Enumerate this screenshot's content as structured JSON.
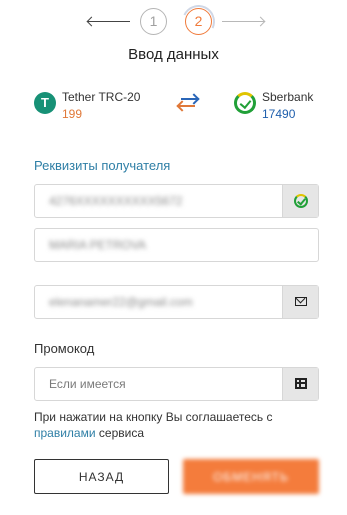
{
  "stepper": {
    "step1": "1",
    "step2": "2"
  },
  "title": "Ввод данных",
  "exchange": {
    "from": {
      "name": "Tether TRC-20",
      "amount": "199",
      "icon": "tether-icon",
      "color": "#179176"
    },
    "to": {
      "name": "Sberbank",
      "amount": "17490",
      "icon": "sberbank-icon",
      "color": "#21a038"
    },
    "swap_icon": "swap-arrows-icon"
  },
  "recipient": {
    "section_title": "Реквизиты получателя",
    "account_value": "4276XXXXXXXXXX5672",
    "account_icon": "sberbank-check-icon",
    "name_value": "MARIA PETROVA",
    "email_value": "elenanamer22@gmail.com",
    "email_icon": "mail-icon"
  },
  "promo": {
    "label": "Промокод",
    "placeholder": "Если имеется",
    "icon": "gift-icon"
  },
  "agreement": {
    "text_before": "При нажатии на кнопку Вы соглашаетесь с ",
    "link": "правилами",
    "text_after": " сервиса"
  },
  "buttons": {
    "back": "НАЗАД",
    "submit": "ОБМЕНЯТЬ"
  },
  "colors": {
    "accent": "#f47c3c",
    "link": "#2f7fa6",
    "secondary_blue": "#1f5fad"
  }
}
